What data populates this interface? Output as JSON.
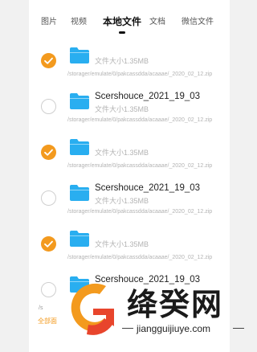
{
  "tabs": [
    {
      "label": "图片"
    },
    {
      "label": "视频"
    },
    {
      "label": "本地文件"
    },
    {
      "label": "文档"
    },
    {
      "label": "微信文件"
    }
  ],
  "files": [
    {
      "checked": true,
      "name": "",
      "size": "文件大小1.35MB",
      "path": "/storager/emulate/0/pakcassdda/acaaae/_2020_02_12.zip"
    },
    {
      "checked": false,
      "name": "Scershouce_2021_19_03",
      "size": "文件大小1.35MB",
      "path": "/storager/emulate/0/pakcassdda/acaaae/_2020_02_12.zip"
    },
    {
      "checked": true,
      "name": "",
      "size": "文件大小1.35MB",
      "path": "/storager/emulate/0/pakcassdda/acaaae/_2020_02_12.zip"
    },
    {
      "checked": false,
      "name": "Scershouce_2021_19_03",
      "size": "文件大小1.35MB",
      "path": "/storager/emulate/0/pakcassdda/acaaae/_2020_02_12.zip"
    },
    {
      "checked": true,
      "name": "",
      "size": "文件大小1.35MB",
      "path": "/storager/emulate/0/pakcassdda/acaaae/_2020_02_12.zip"
    },
    {
      "checked": false,
      "name": "Scershouce_2021_19_03",
      "size": "",
      "path": ""
    }
  ],
  "footer": {
    "selected_text": "/s",
    "select_all_label": "全部面"
  },
  "watermark": {
    "brand": "绛癸网",
    "domain": "jiangguijiuye.com"
  },
  "colors": {
    "accent": "#f39a1e",
    "folder": "#29aef0"
  }
}
